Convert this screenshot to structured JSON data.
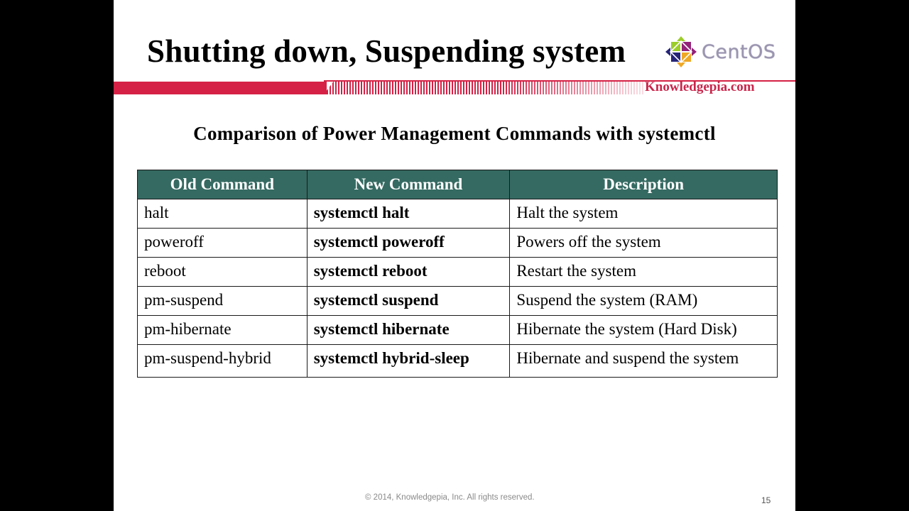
{
  "slide": {
    "title": "Shutting down, Suspending system",
    "logo": {
      "icon": "centos-logo-icon",
      "text": "CentOS",
      "colors": {
        "green": "#9ccd2a",
        "purple": "#932279",
        "orange": "#efa724",
        "navy": "#262577",
        "text": "#9b95b0"
      }
    },
    "site_label": "Knowledgepia.com",
    "accent_color": "#d42145",
    "subtitle": "Comparison of Power Management Commands with systemctl",
    "table": {
      "header_color": "#356a62",
      "columns": [
        "Old Command",
        "New Command",
        "Description"
      ],
      "rows": [
        {
          "old": "halt",
          "new": "systemctl halt",
          "desc": "Halt the system"
        },
        {
          "old": "poweroff",
          "new": "systemctl poweroff",
          "desc": "Powers off the system"
        },
        {
          "old": "reboot",
          "new": "systemctl reboot",
          "desc": "Restart the system"
        },
        {
          "old": "pm-suspend",
          "new": "systemctl suspend",
          "desc": "Suspend the system (RAM)"
        },
        {
          "old": "pm-hibernate",
          "new": "systemctl hibernate",
          "desc": "Hibernate the system (Hard Disk)"
        },
        {
          "old": "pm-suspend-hybrid",
          "new": "systemctl hybrid-sleep",
          "desc": "Hibernate and suspend the system"
        }
      ]
    },
    "footer": "© 2014, Knowledgepia, Inc. All rights reserved.",
    "page_number": "15"
  }
}
